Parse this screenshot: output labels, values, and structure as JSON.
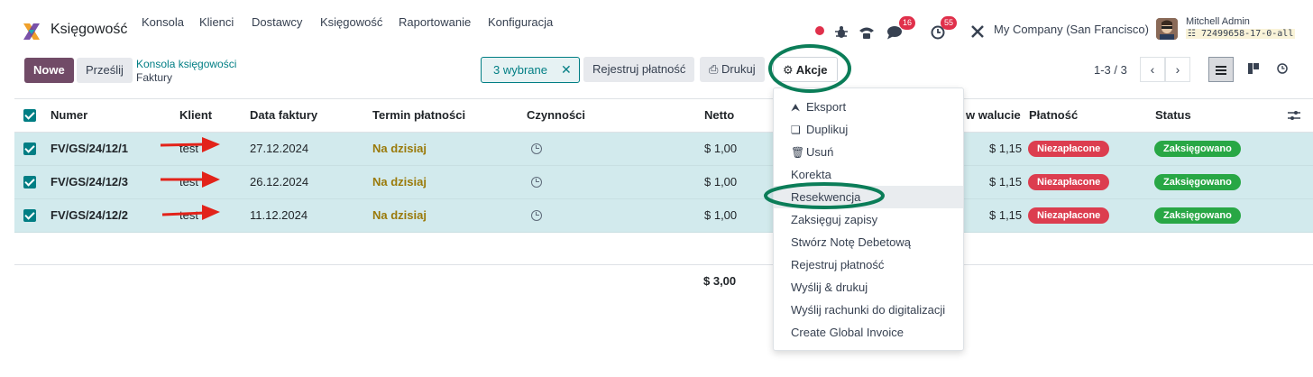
{
  "navbar": {
    "app_name": "Księgowość",
    "menu": [
      "Konsola",
      "Klienci",
      "Dostawcy",
      "Księgowość",
      "Raportowanie",
      "Konfiguracja"
    ],
    "chat_badge": "16",
    "activity_badge": "55",
    "company": "My Company (San Francisco)",
    "user_name": "Mitchell Admin",
    "db_name": "72499658-17-0-all"
  },
  "control": {
    "new_label": "Nowe",
    "upload_label": "Prześlij",
    "breadcrumb_parent": "Konsola księgowości",
    "breadcrumb_current": "Faktury",
    "selected_label": "3 wybrane",
    "register_payment_label": "Rejestruj płatność",
    "print_label": "Drukuj",
    "actions_label": "Akcje",
    "pager": "1-3 / 3"
  },
  "table": {
    "columns": [
      "Numer",
      "Klient",
      "Data faktury",
      "Termin płatności",
      "Czynności",
      "Netto",
      "w walucie",
      "Płatność",
      "Status"
    ],
    "rows": [
      {
        "number": "FV/GS/24/12/1",
        "client": "test",
        "date": "27.12.2024",
        "due": "Na dzisiaj",
        "net": "$ 1,00",
        "total_currency": "$ 1,15",
        "payment": "Niezapłacone",
        "status": "Zaksięgowano"
      },
      {
        "number": "FV/GS/24/12/3",
        "client": "test",
        "date": "26.12.2024",
        "due": "Na dzisiaj",
        "net": "$ 1,00",
        "total_currency": "$ 1,15",
        "payment": "Niezapłacone",
        "status": "Zaksięgowano"
      },
      {
        "number": "FV/GS/24/12/2",
        "client": "test",
        "date": "11.12.2024",
        "due": "Na dzisiaj",
        "net": "$ 1,00",
        "total_currency": "$ 1,15",
        "payment": "Niezapłacone",
        "status": "Zaksięgowano"
      }
    ],
    "total_net": "$ 3,00"
  },
  "actions_menu": {
    "items": [
      {
        "label": "Eksport",
        "icon": "upload-icon"
      },
      {
        "label": "Duplikuj",
        "icon": "copy-icon"
      },
      {
        "label": "Usuń",
        "icon": "trash-icon"
      },
      {
        "label": "Korekta"
      },
      {
        "label": "Resekwencja"
      },
      {
        "label": "Zaksięguj zapisy"
      },
      {
        "label": "Stwórz Notę Debetową"
      },
      {
        "label": "Rejestruj płatność"
      },
      {
        "label": "Wyślij & drukuj"
      },
      {
        "label": "Wyślij rachunki do digitalizacji"
      },
      {
        "label": "Create Global Invoice"
      }
    ]
  },
  "colors": {
    "brand": "#714b67",
    "accent": "#017e84",
    "selected_row": "#d2eaed",
    "danger": "#dc3d4f",
    "success": "#28a745",
    "annotation_green": "#0b7d58",
    "annotation_red": "#e2231a"
  }
}
